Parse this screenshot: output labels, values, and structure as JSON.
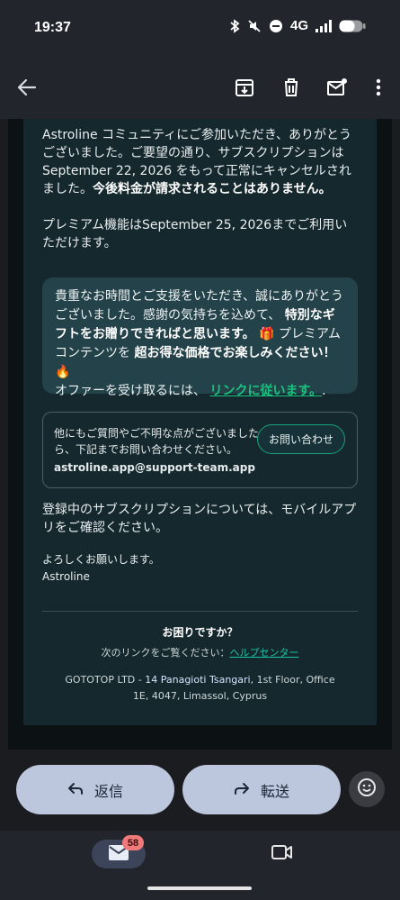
{
  "status_bar": {
    "time": "19:37",
    "network": "4G"
  },
  "app_bar": {
    "icons": [
      "back-arrow-icon",
      "archive-icon",
      "delete-icon",
      "mark-unread-icon",
      "more-vert-icon"
    ]
  },
  "email": {
    "p1_a": "Astroline コミュニティにご参加いただき、ありがとうございました。ご要望の通り、サブスクリプションは September 22, 2026 をもって正常にキャンセルされました。",
    "p1_b": "今後料金が請求されることはありません。",
    "p2": "プレミアム機能はSeptember 25, 2026までご利用いただけます。",
    "promo": {
      "t1": "貴重なお時間とご支援をいただき、誠にありがとうございました。感謝の気持ちを込めて、",
      "t2": "特別なギフトをお贈りできればと思います。",
      "t3": "🎁 プレミアムコンテンツを",
      "t4": "超お得な価格でお楽しみください！",
      "t5": "🔥",
      "t6": "オファーを受け取るには、",
      "link": "リンクに従います。",
      "t7": "."
    },
    "support": {
      "text": "他にもご質問やご不明な点がございましたら、下記までお問い合わせください。",
      "email": "astroline.app@support-team.app",
      "button": "お問い合わせ"
    },
    "p3": "登録中のサブスクリプションについては、モバイルアプリをご確認ください。",
    "signoff_1": "よろしくお願いします。",
    "signoff_2": "Astroline",
    "footer": {
      "title": "お困りですか？",
      "help_prefix": "次のリンクをご覧ください：",
      "help_link": "ヘルプセンター",
      "addr_1": "GOTOTOP LTD - ",
      "addr_hl": "14 Panagioti Tsangari",
      "addr_2": ", 1st Floor, Office",
      "addr_3": "1E, 4047, Limassol, Cyprus"
    }
  },
  "actions": {
    "reply": "返信",
    "forward": "転送"
  },
  "nav": {
    "mail_badge": "58"
  },
  "colors": {
    "accent_green": "#19c37f",
    "card_bg": "#14282d",
    "pill_bg": "#bcc7de"
  }
}
